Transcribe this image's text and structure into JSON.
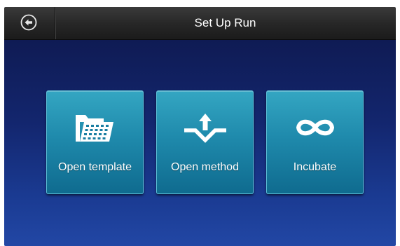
{
  "header": {
    "title": "Set Up Run",
    "back_icon": "back-arrow-circle-icon"
  },
  "tiles": [
    {
      "label": "Open template",
      "icon": "folder-plate-icon"
    },
    {
      "label": "Open method",
      "icon": "method-upload-icon"
    },
    {
      "label": "Incubate",
      "icon": "infinity-icon"
    }
  ],
  "colors": {
    "header_bg": "#262626",
    "content_bg_top": "#0f1b54",
    "content_bg_bottom": "#2247a5",
    "tile_bg_top": "#34a6c2",
    "tile_bg_bottom": "#0f6b8f",
    "text": "#ffffff"
  }
}
